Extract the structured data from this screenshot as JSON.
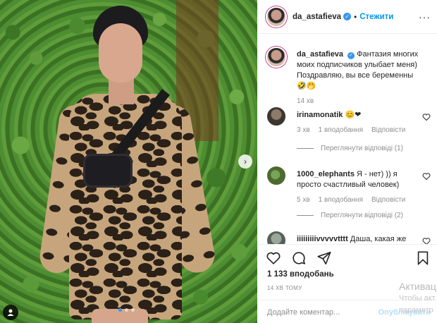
{
  "post": {
    "author": "da_astafieva",
    "follow_label": "Стежити",
    "separator": "•",
    "more": "···"
  },
  "caption": {
    "author": "da_astafieva",
    "text_line1": " Фантазия многих моих подписчиков улыбает меня)",
    "text_line2": "Поздравляю, вы все беременны🤣🤭",
    "time": "14 хв"
  },
  "comments": [
    {
      "user": "irinamonatik",
      "text": " 😊❤",
      "time": "3 хв",
      "likes": "1 вподобання",
      "reply": "Відповісти",
      "view_replies": "Переглянути відповіді (1)"
    },
    {
      "user": "1000_elephants",
      "text": " Я - нет) )) я просто счастливый человек)",
      "time": "5 хв",
      "likes": "1 вподобання",
      "reply": "Відповісти",
      "view_replies": "Переглянути відповіді (2)"
    },
    {
      "user": "iiiiiiiiivvvvvtttt",
      "text": " Даша, какая же"
    }
  ],
  "footer": {
    "likes": "1 133 вподобань",
    "posted": "14 ХВ ТОМУ",
    "comment_placeholder": "Додайте коментар...",
    "publish": "Опублікувати"
  },
  "watermark": {
    "line1": "Активац",
    "line2": "Чтобы акт параметр"
  },
  "colors": {
    "accent": "#0095f6",
    "verified": "#3897f0",
    "muted": "#8e8e8e",
    "publish_disabled": "#b2dffc"
  }
}
